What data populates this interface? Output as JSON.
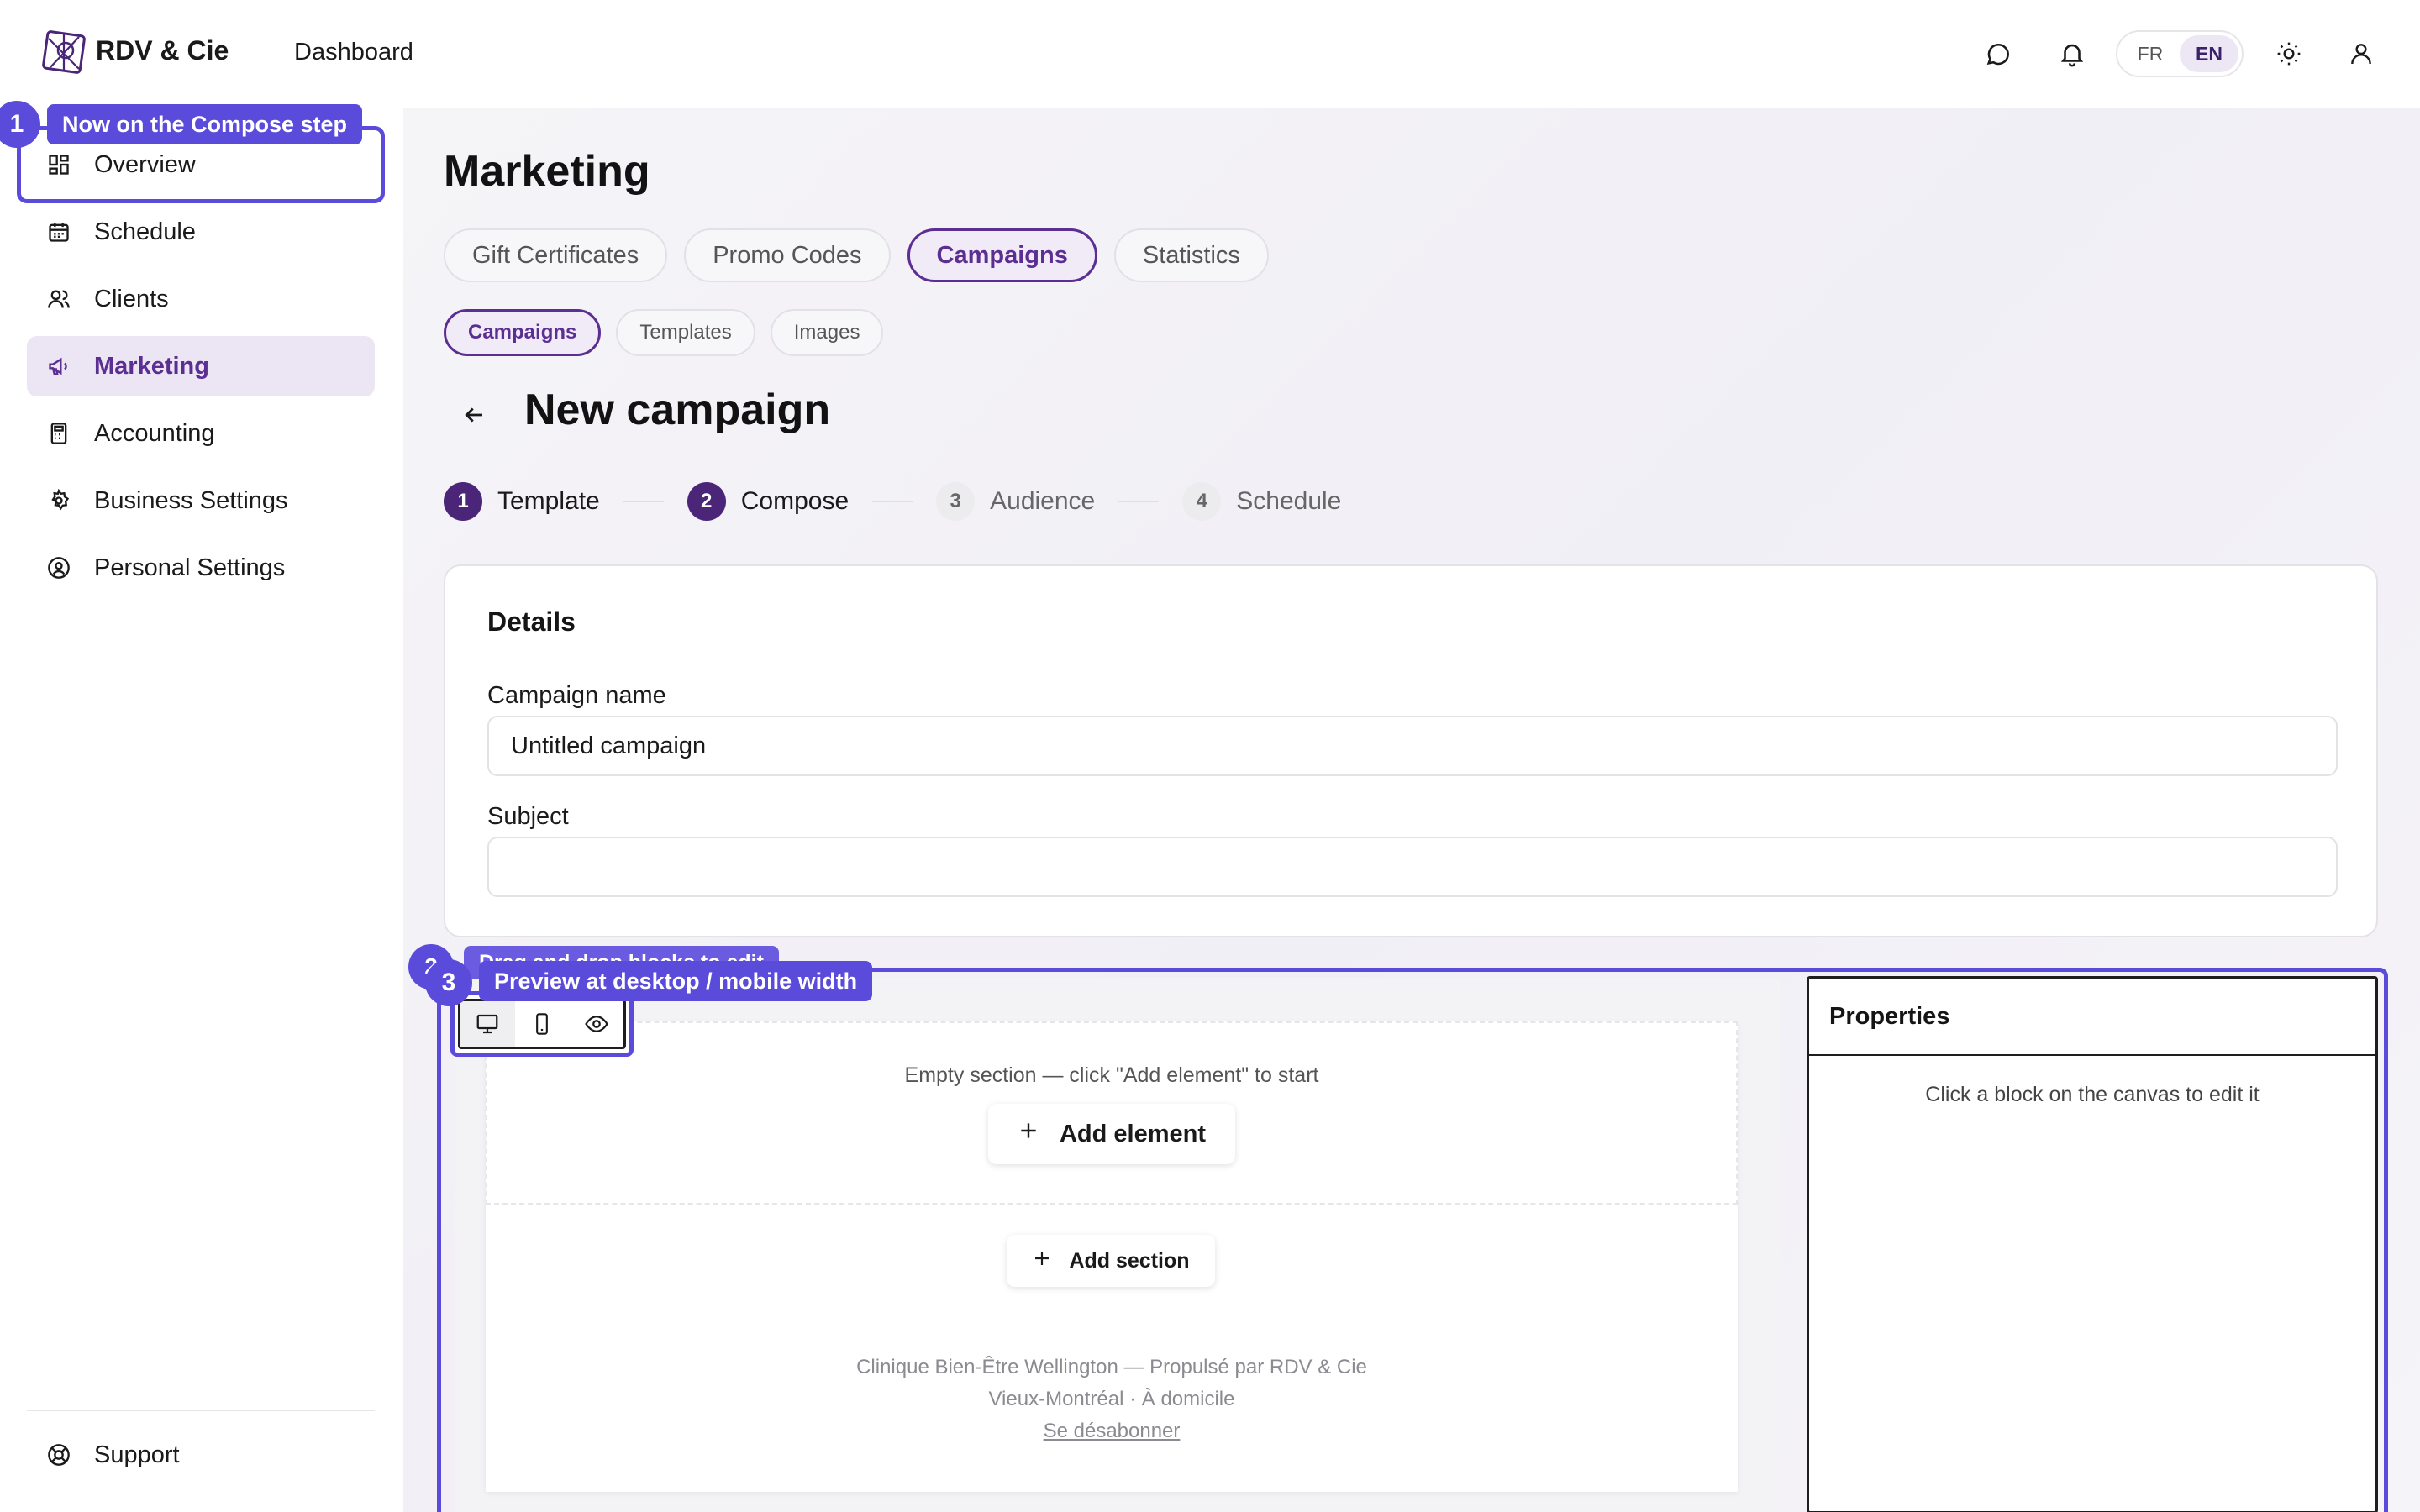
{
  "app": {
    "brand": "RDV & Cie",
    "top_nav": "Dashboard",
    "lang": {
      "fr": "FR",
      "en": "EN",
      "active": "EN"
    }
  },
  "sidebar": {
    "items": [
      {
        "label": "Overview",
        "icon": "grid-icon"
      },
      {
        "label": "Schedule",
        "icon": "calendar-icon"
      },
      {
        "label": "Clients",
        "icon": "users-icon"
      },
      {
        "label": "Marketing",
        "icon": "megaphone-icon",
        "active": true
      },
      {
        "label": "Accounting",
        "icon": "calculator-icon"
      },
      {
        "label": "Business Settings",
        "icon": "gear-icon"
      },
      {
        "label": "Personal Settings",
        "icon": "user-circle-icon"
      }
    ],
    "support": "Support"
  },
  "page": {
    "title": "Marketing",
    "tabs": [
      "Gift Certificates",
      "Promo Codes",
      "Campaigns",
      "Statistics"
    ],
    "active_tab": "Campaigns",
    "subtabs": [
      "Campaigns",
      "Templates",
      "Images"
    ],
    "active_subtab": "Campaigns",
    "campaign_title": "New campaign",
    "steps": [
      {
        "num": "1",
        "label": "Template",
        "state": "done"
      },
      {
        "num": "2",
        "label": "Compose",
        "state": "current"
      },
      {
        "num": "3",
        "label": "Audience",
        "state": "todo"
      },
      {
        "num": "4",
        "label": "Schedule",
        "state": "todo"
      }
    ]
  },
  "details": {
    "title": "Details",
    "campaign_name_label": "Campaign name",
    "campaign_name_value": "Untitled campaign",
    "subject_label": "Subject",
    "subject_value": ""
  },
  "editor": {
    "empty_section_text": "Empty section — click \"Add element\" to start",
    "add_element": "Add element",
    "add_section": "Add section",
    "footer_line1": "Clinique Bien-Être Wellington — Propulsé par RDV & Cie",
    "footer_line2": "Vieux-Montréal · À domicile",
    "footer_link": "Se désabonner"
  },
  "properties": {
    "title": "Properties",
    "empty_text": "Click a block on the canvas to edit it"
  },
  "tour": {
    "step1_num": "1",
    "step1_text": "Now on the Compose step",
    "step3_num": "3",
    "step3_text": "Preview at desktop / mobile width",
    "step2_num": "2",
    "step2_text_partial": "Drag and drop blocks to edit"
  },
  "colors": {
    "accent": "#5b2e91",
    "tour": "#5b4bdb"
  }
}
